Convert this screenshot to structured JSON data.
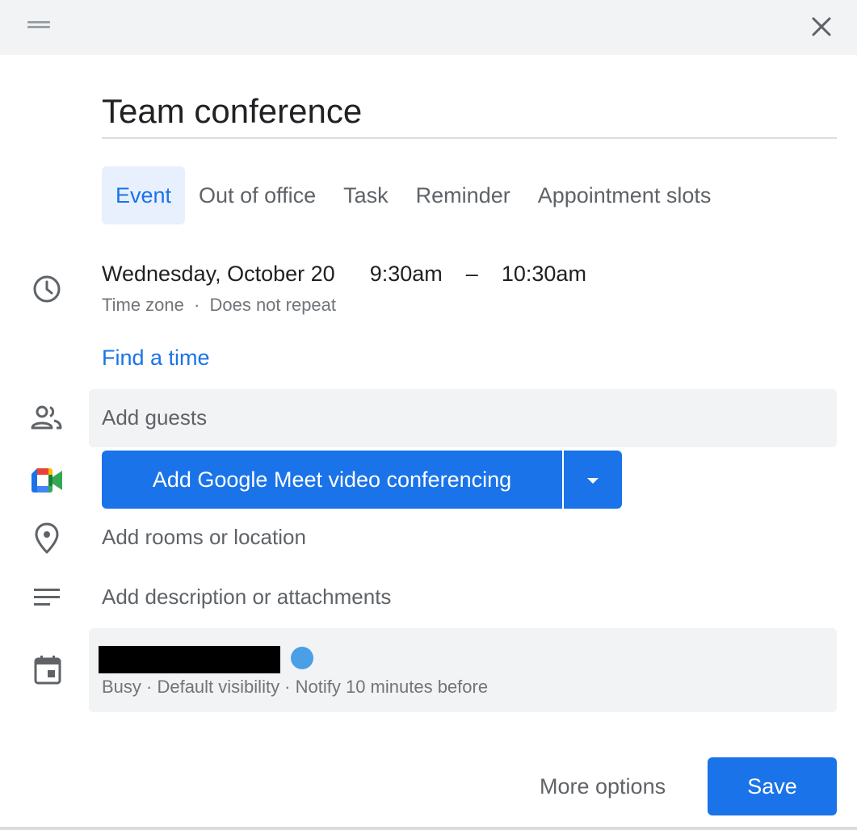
{
  "dialog": {
    "title": "Team conference",
    "close_label": "close"
  },
  "tabs": [
    {
      "label": "Event",
      "active": true
    },
    {
      "label": "Out of office",
      "active": false
    },
    {
      "label": "Task",
      "active": false
    },
    {
      "label": "Reminder",
      "active": false
    },
    {
      "label": "Appointment slots",
      "active": false
    }
  ],
  "when": {
    "date": "Wednesday, October 20",
    "start_time": "9:30am",
    "separator": "–",
    "end_time": "10:30am",
    "time_zone": "Time zone",
    "dot": "·",
    "repeat": "Does not repeat",
    "find_time": "Find a time"
  },
  "guests": {
    "placeholder": "Add guests"
  },
  "meet": {
    "label": "Add Google Meet video conferencing"
  },
  "location": {
    "label": "Add rooms or location"
  },
  "description": {
    "label": "Add description or attachments"
  },
  "calendar": {
    "color": "#4a9fe6",
    "details": "Busy · Default visibility · Notify 10 minutes before"
  },
  "footer": {
    "more_options": "More options",
    "save": "Save"
  },
  "icons": {
    "clock": "clock-icon",
    "people": "people-icon",
    "meet": "google-meet-icon",
    "location": "location-pin-icon",
    "description": "notes-icon",
    "calendar": "calendar-icon"
  },
  "colors": {
    "accent": "#1a73e8",
    "tab_active_bg": "#e8f0fe",
    "field_bg": "#f1f3f4"
  }
}
